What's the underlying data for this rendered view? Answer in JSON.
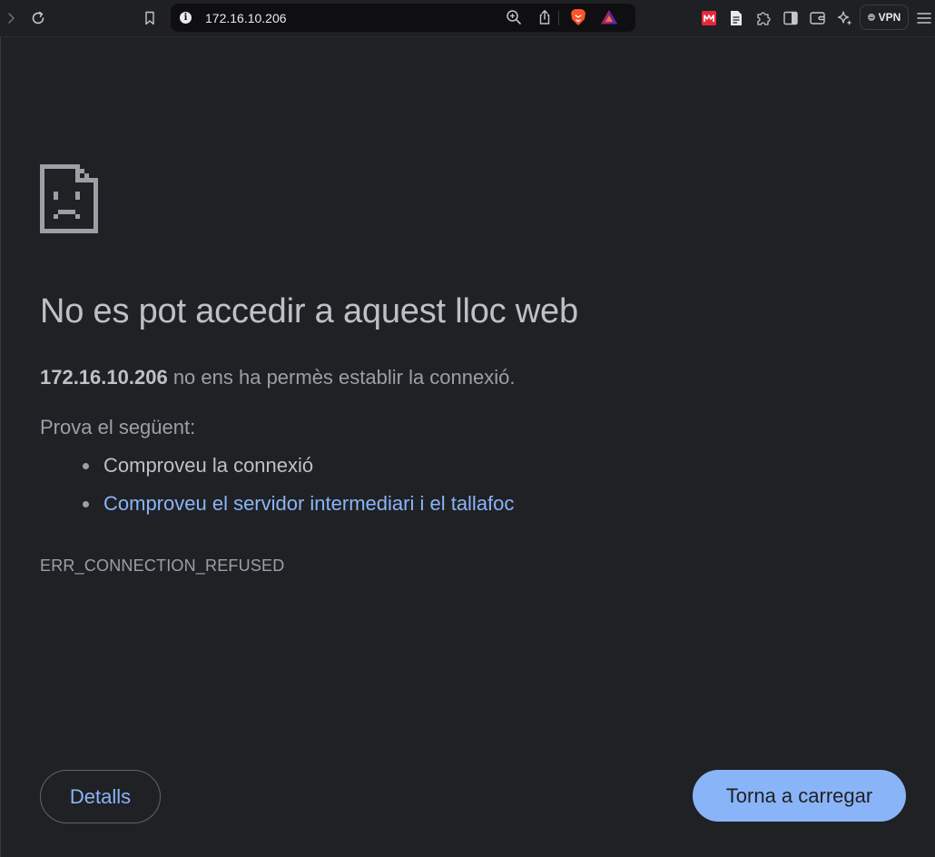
{
  "browser": {
    "address_bar": {
      "url": "172.16.10.206"
    },
    "vpn_label": "VPN",
    "icons": {
      "forward": "chevron-right-icon",
      "reload": "reload-icon",
      "bookmark": "bookmark-icon",
      "site_info": "info-icon",
      "zoom": "zoom-in-icon",
      "share": "share-icon",
      "brave_shields": "brave-lion-icon",
      "brave_rewards": "triangle-icon",
      "ext_red": "red-extension-icon",
      "reader": "document-icon",
      "extensions": "puzzle-icon",
      "sidebar": "sidebar-icon",
      "wallet": "wallet-icon",
      "leo": "sparkle-icon",
      "menu": "hamburger-menu-icon"
    },
    "colors": {
      "brave_orange": "#fb542b",
      "link_blue": "#8ab4f8",
      "ext_red": "#e8273c"
    }
  },
  "error_page": {
    "icon": "sad-document-icon",
    "title": "No es pot accedir a aquest lloc web",
    "summary_host": "172.16.10.206",
    "summary_text": " no ens ha permès establir la connexió.",
    "suggestions_heading": "Prova el següent:",
    "suggestions": [
      {
        "label": "Comproveu la connexió"
      },
      {
        "label": "Comproveu el servidor intermediari i el tallafoc"
      }
    ],
    "error_code": "ERR_CONNECTION_REFUSED",
    "details_button": "Detalls",
    "reload_button": "Torna a carregar"
  }
}
